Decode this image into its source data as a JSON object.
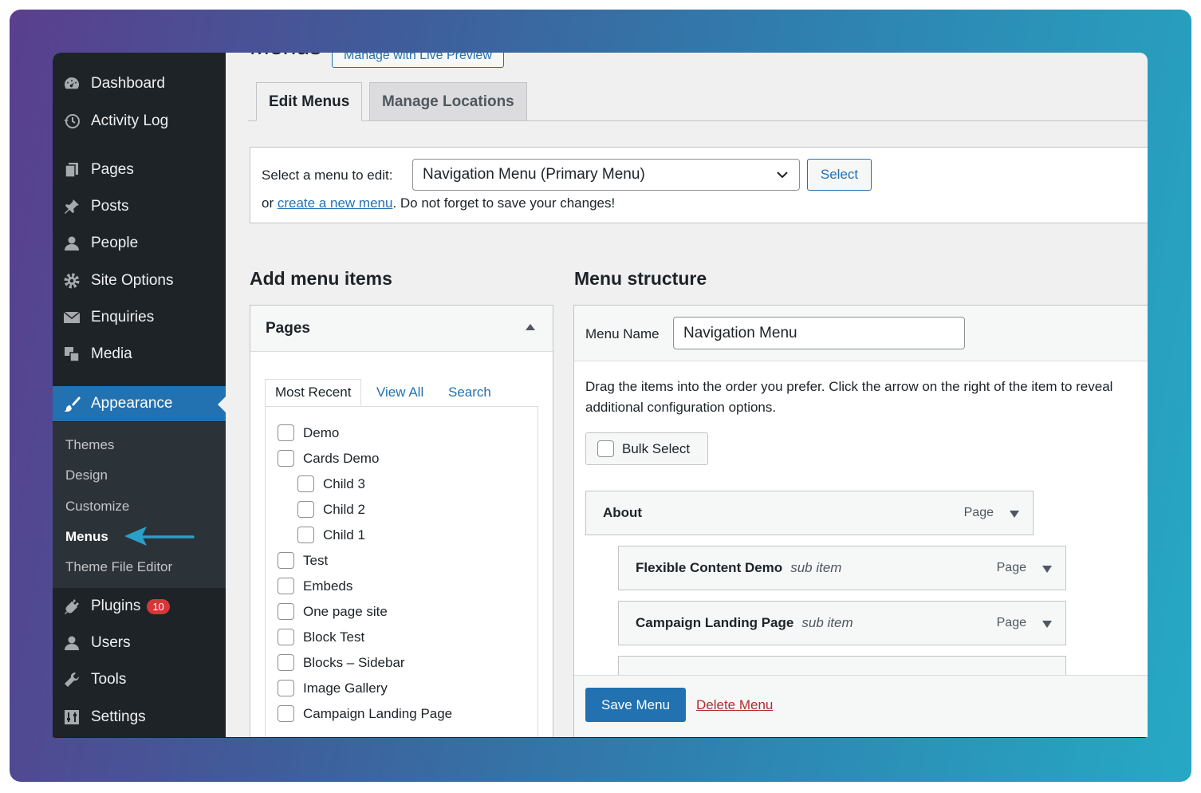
{
  "sidebar": {
    "items": [
      {
        "label": "Dashboard",
        "icon": "dashboard-icon"
      },
      {
        "label": "Activity Log",
        "icon": "history-icon"
      },
      {
        "label": "Pages",
        "icon": "pages-icon"
      },
      {
        "label": "Posts",
        "icon": "pin-icon"
      },
      {
        "label": "People",
        "icon": "person-icon"
      },
      {
        "label": "Site Options",
        "icon": "gear-icon"
      },
      {
        "label": "Enquiries",
        "icon": "envelope-icon"
      },
      {
        "label": "Media",
        "icon": "media-icon"
      },
      {
        "label": "Appearance",
        "icon": "paintbrush-icon"
      },
      {
        "label": "Plugins",
        "icon": "plugin-icon"
      },
      {
        "label": "Users",
        "icon": "users-icon"
      },
      {
        "label": "Tools",
        "icon": "wrench-icon"
      },
      {
        "label": "Settings",
        "icon": "settings-icon"
      }
    ],
    "plugins_badge": "10",
    "submenu": [
      "Themes",
      "Design",
      "Customize",
      "Menus",
      "Theme File Editor"
    ]
  },
  "header": {
    "title": "Menus",
    "live_preview": "Manage with Live Preview"
  },
  "tabs": [
    "Edit Menus",
    "Manage Locations"
  ],
  "select_menu": {
    "label": "Select a menu to edit:",
    "value": "Navigation Menu (Primary Menu)",
    "button": "Select",
    "or": "or ",
    "create_link": "create a new menu",
    "suffix": ". Do not forget to save your changes!"
  },
  "add_items": {
    "title": "Add menu items",
    "box_title": "Pages",
    "tabs": [
      "Most Recent",
      "View All",
      "Search"
    ],
    "pages": [
      {
        "label": "Demo",
        "level": 0
      },
      {
        "label": "Cards Demo",
        "level": 0
      },
      {
        "label": "Child 3",
        "level": 1
      },
      {
        "label": "Child 2",
        "level": 1
      },
      {
        "label": "Child 1",
        "level": 1
      },
      {
        "label": "Test",
        "level": 0
      },
      {
        "label": "Embeds",
        "level": 0
      },
      {
        "label": "One page site",
        "level": 0
      },
      {
        "label": "Block Test",
        "level": 0
      },
      {
        "label": "Blocks – Sidebar",
        "level": 0
      },
      {
        "label": "Image Gallery",
        "level": 0
      },
      {
        "label": "Campaign Landing Page",
        "level": 0
      }
    ]
  },
  "structure": {
    "title": "Menu structure",
    "name_label": "Menu Name",
    "name_value": "Navigation Menu",
    "instructions_1": "Drag the items into the order you prefer. Click the arrow on the right of the item to reveal",
    "instructions_2": "additional configuration options.",
    "bulk_select": "Bulk Select",
    "items": [
      {
        "title": "About",
        "sub": "",
        "type": "Page"
      },
      {
        "title": "Flexible Content Demo",
        "sub": "sub item",
        "type": "Page"
      },
      {
        "title": "Campaign Landing Page",
        "sub": "sub item",
        "type": "Page"
      }
    ],
    "save": "Save Menu",
    "delete": "Delete Menu"
  },
  "colors": {
    "accent": "#2271b1",
    "sidebar": "#1d2327",
    "danger": "#b32d2e"
  }
}
